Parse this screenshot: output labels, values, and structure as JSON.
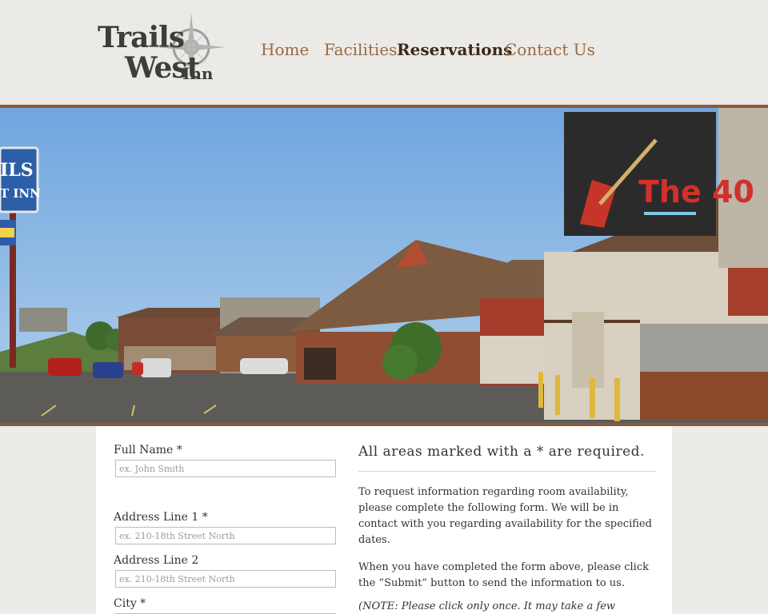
{
  "header": {
    "logo": {
      "line1": "Trails",
      "line2": "West",
      "inn": "Inn"
    },
    "nav": [
      {
        "label": "Home",
        "active": false
      },
      {
        "label": "Facilities",
        "active": false
      },
      {
        "label": "Reservations",
        "active": true
      },
      {
        "label": "Contact Us",
        "active": false
      }
    ]
  },
  "banner": {
    "sign_text": "The 40",
    "pole_sign_top": "ILS",
    "pole_sign_bottom": "T INN"
  },
  "form": {
    "fields": [
      {
        "label": "Full Name *",
        "placeholder": "ex. John Smith"
      },
      {
        "label": "Address Line 1 *",
        "placeholder": "ex. 210-18th Street North"
      },
      {
        "label": "Address Line 2",
        "placeholder": "ex. 210-18th Street North"
      },
      {
        "label": "City *",
        "placeholder": ""
      }
    ]
  },
  "info": {
    "required_note": "All areas marked with a * are required.",
    "paragraph1": "To request information regarding room availability, please complete the following form. We will be in contact with you regarding availability for the specified dates.",
    "paragraph2": "When you have completed the form above, please click the “Submit” button to send the information to us.",
    "note": "(NOTE: Please click only once. It may take a few seconds to process your request.)"
  },
  "colors": {
    "nav_link": "#9a6a3f",
    "nav_active": "#3d2a1a",
    "divider_brown": "#8b5a3a",
    "page_bg": "#ecebe8"
  }
}
